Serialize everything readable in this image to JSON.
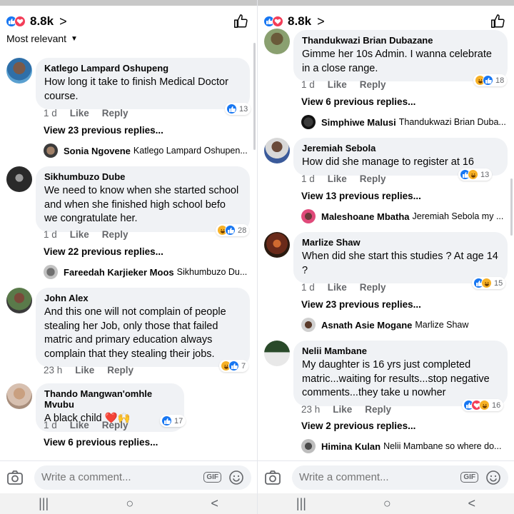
{
  "left": {
    "header": {
      "reaction_count": "8.8k",
      "chevron": ">"
    },
    "sort_label": "Most relevant",
    "comments": [
      {
        "author": "Katlego Lampard Oshupeng",
        "text": "How long it take to finish Medical Doctor course.",
        "time": "1 d",
        "like": "Like",
        "reply": "Reply",
        "reactions": [
          "like"
        ],
        "reaction_count": "13",
        "view_more": "View 23 previous replies...",
        "preview_name": "Sonia Ngovene",
        "preview_text": "Katlego Lampard Oshupen..."
      },
      {
        "author": "Sikhumbuzo Dube",
        "text": "We need to know when she started school and when she finished high school befo we congratulate her.",
        "time": "1 d",
        "like": "Like",
        "reply": "Reply",
        "reactions": [
          "haha",
          "like"
        ],
        "reaction_count": "28",
        "view_more": "View 22 previous replies...",
        "preview_name": "Fareedah Karjieker Moos",
        "preview_text": "Sikhumbuzo Du..."
      },
      {
        "author": "John Alex",
        "text": "And this one will not complain of people stealing her Job, only those that failed matric and primary education always complain that they stealing their jobs.",
        "time": "23 h",
        "like": "Like",
        "reply": "Reply",
        "reactions": [
          "haha",
          "like"
        ],
        "reaction_count": "7"
      },
      {
        "author": "Thando Mangwan'omhle Mvubu",
        "text": "A black child ❤️🙌",
        "time": "1 d",
        "like": "Like",
        "reply": "Reply",
        "reactions": [
          "like"
        ],
        "reaction_count": "17",
        "view_more": "View 6 previous replies..."
      }
    ],
    "composer": {
      "placeholder": "Write a comment...",
      "gif": "GIF"
    }
  },
  "right": {
    "header": {
      "reaction_count": "8.8k",
      "chevron": ">"
    },
    "comments": [
      {
        "author": "Thandukwazi Brian Dubazane",
        "text": "Gimme her 10s Admin. I wanna celebrate in a close range.",
        "time": "1 d",
        "like": "Like",
        "reply": "Reply",
        "reactions": [
          "haha",
          "like"
        ],
        "reaction_count": "18",
        "view_more": "View 6 previous replies...",
        "preview_name": "Simphiwe Malusi",
        "preview_text": "Thandukwazi Brian Duba..."
      },
      {
        "author": "Jeremiah Sebola",
        "text": "How did she manage to register at 16",
        "time": "1 d",
        "like": "Like",
        "reply": "Reply",
        "reactions": [
          "like",
          "haha"
        ],
        "reaction_count": "13",
        "view_more": "View 13 previous replies...",
        "preview_name": "Maleshoane Mbatha",
        "preview_text": "Jeremiah Sebola my ..."
      },
      {
        "author": "Marlize Shaw",
        "text": "When did she start this studies ? At age 14 ?",
        "time": "1 d",
        "like": "Like",
        "reply": "Reply",
        "reactions": [
          "like",
          "haha"
        ],
        "reaction_count": "15",
        "view_more": "View 23 previous replies...",
        "preview_name": "Asnath Asie Mogane",
        "preview_text": "Marlize Shaw"
      },
      {
        "author": "Nelii Mambane",
        "text": "My daughter  is 16 yrs just completed matric...waiting for results...stop negative  comments...they take u nowher",
        "time": "23 h",
        "like": "Like",
        "reply": "Reply",
        "reactions": [
          "like",
          "love",
          "haha"
        ],
        "reaction_count": "16",
        "view_more": "View 2 previous replies...",
        "preview_name": "Himina Kulan",
        "preview_text": "Nelii Mambane so where do..."
      }
    ],
    "composer": {
      "placeholder": "Write a comment...",
      "gif": "GIF"
    }
  },
  "nav": {
    "recents": "|||",
    "home": "○",
    "back": "<"
  }
}
